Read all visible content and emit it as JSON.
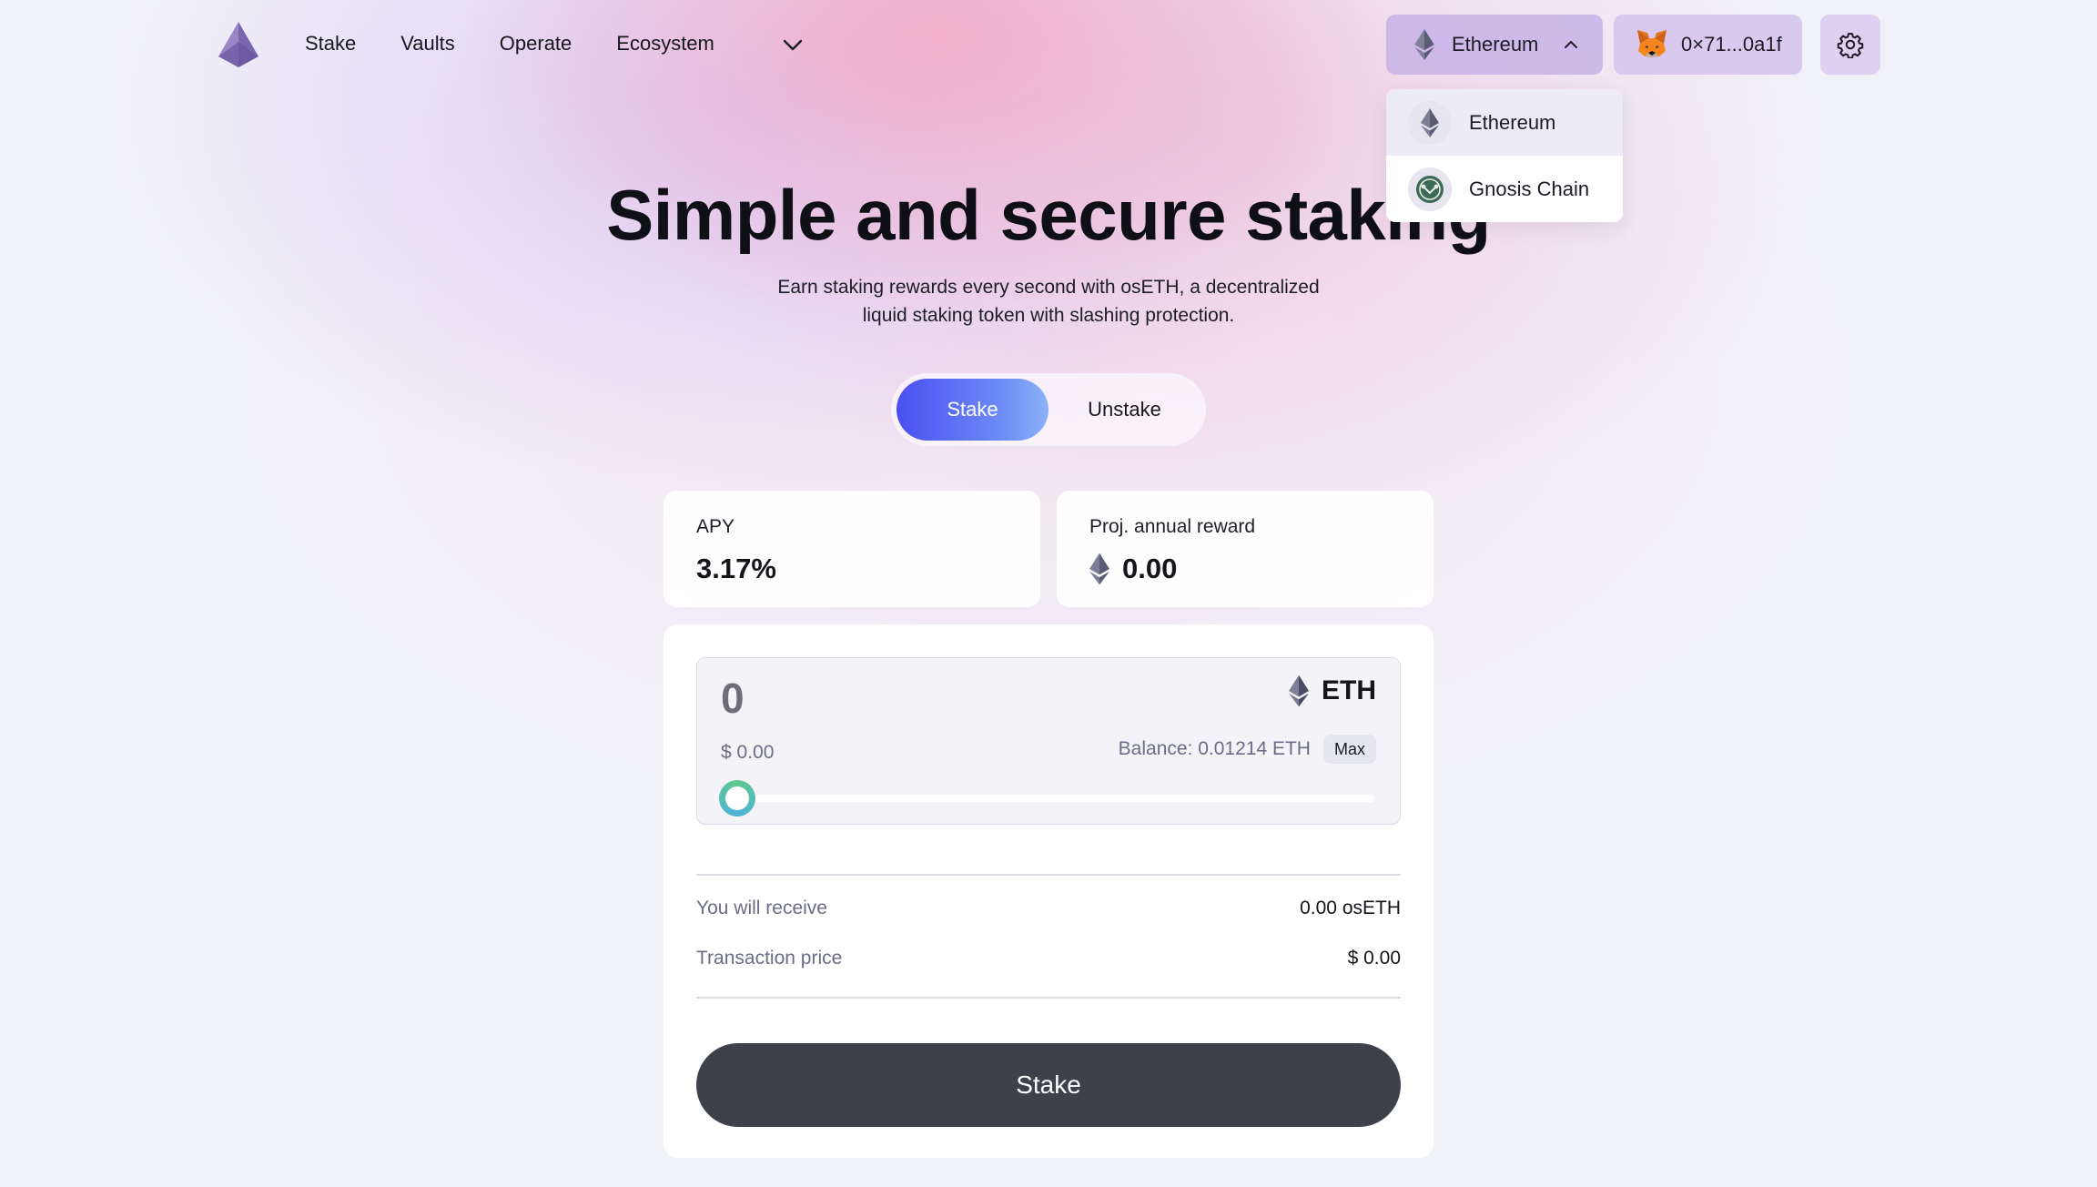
{
  "header": {
    "nav": [
      "Stake",
      "Vaults",
      "Operate",
      "Ecosystem"
    ],
    "network": "Ethereum",
    "wallet": "0×71...0a1f"
  },
  "network_dropdown": {
    "options": [
      "Ethereum",
      "Gnosis Chain"
    ],
    "selected": "Ethereum"
  },
  "hero": {
    "title": "Simple and secure staking",
    "subtitle_line1": "Earn staking rewards every second with osETH, a decentralized",
    "subtitle_line2": "liquid staking token with slashing protection."
  },
  "tabs": [
    "Stake",
    "Unstake"
  ],
  "stats": {
    "apy_label": "APY",
    "apy_value": "3.17%",
    "reward_label": "Proj. annual reward",
    "reward_value": "0.00"
  },
  "form": {
    "amount": "0",
    "token": "ETH",
    "usd_value": "$ 0.00",
    "balance": "Balance: 0.01214 ETH",
    "max_label": "Max",
    "slider_fraction": 0,
    "receive_label": "You will receive",
    "receive_value": "0.00 osETH",
    "tx_label": "Transaction price",
    "tx_value": "$ 0.00",
    "submit_label": "Stake"
  },
  "colors": {
    "primary_gradient_start": "#4a4ff2",
    "primary_gradient_end": "#8db2f8",
    "button_dark": "#3e4149",
    "slider_ring": "#5ec98e"
  },
  "icons": [
    "stakewise-logo-icon",
    "chevron-down-icon",
    "ethereum-icon",
    "metamask-fox-icon",
    "gear-icon",
    "gnosis-icon"
  ]
}
